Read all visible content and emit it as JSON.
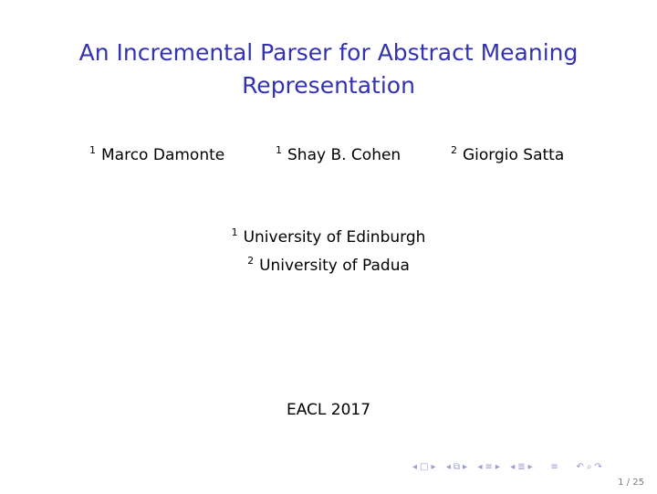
{
  "slide": {
    "title_line1": "An Incremental Parser for Abstract Meaning",
    "title_line2": "Representation",
    "authors": [
      {
        "mark": "1",
        "name": "Marco Damonte"
      },
      {
        "mark": "1",
        "name": "Shay B. Cohen"
      },
      {
        "mark": "2",
        "name": "Giorgio Satta"
      }
    ],
    "affiliations": [
      {
        "mark": "1",
        "name": "University of Edinburgh"
      },
      {
        "mark": "2",
        "name": "University of Padua"
      }
    ],
    "conference": "EACL 2017",
    "page": "1 / 25",
    "title_color": "#3333b2"
  },
  "nav": {
    "frame_prev": "◂",
    "frame_icon": "□",
    "frame_next": "▸",
    "sub_prev": "◂",
    "sub_icon": "⧉",
    "sub_next": "▸",
    "sec_prev": "◂",
    "sec_icon": "≡",
    "sec_next": "▸",
    "subsec_prev": "◂",
    "subsec_icon": "≣",
    "subsec_next": "▸",
    "toc_icon": "≡",
    "back_icon": "↶",
    "search_icon": "⌕",
    "forward_icon": "↷"
  }
}
